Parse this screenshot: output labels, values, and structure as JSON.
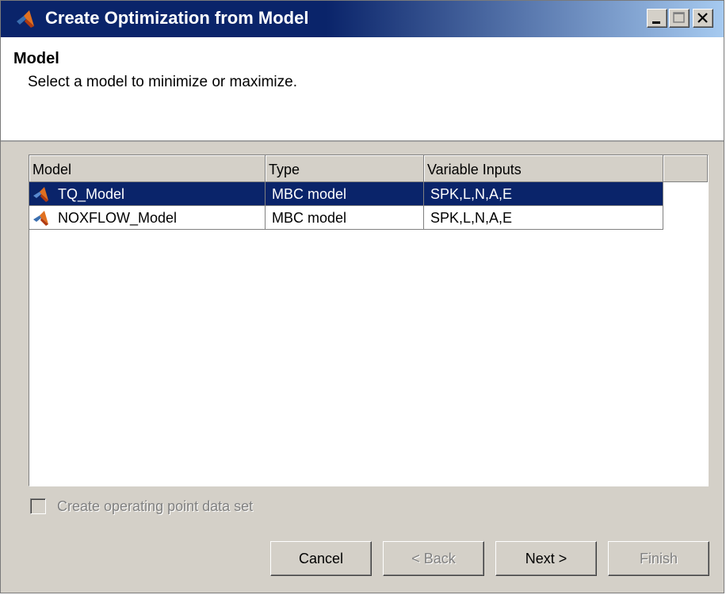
{
  "window": {
    "title": "Create Optimization from Model",
    "minimize_label": "_",
    "maximize_label": "□",
    "close_label": "×"
  },
  "header": {
    "title": "Model",
    "description": "Select a model to minimize or maximize."
  },
  "table": {
    "columns": [
      "Model",
      "Type",
      "Variable Inputs"
    ],
    "rows": [
      {
        "model": "TQ_Model",
        "type": "MBC model",
        "inputs": "SPK,L,N,A,E",
        "selected": true,
        "icon": "matlab-model-icon"
      },
      {
        "model": "NOXFLOW_Model",
        "type": "MBC model",
        "inputs": "SPK,L,N,A,E",
        "selected": false,
        "icon": "matlab-model-icon"
      }
    ]
  },
  "options": {
    "create_opdata_label": "Create operating point data set",
    "create_opdata_checked": false,
    "create_opdata_enabled": false
  },
  "buttons": {
    "cancel": "Cancel",
    "back": "< Back",
    "next": "Next >",
    "finish": "Finish"
  },
  "colors": {
    "titlebar_start": "#0a246a",
    "titlebar_end": "#a6caf0",
    "selection": "#0a246a",
    "dialog_bg": "#d4d0c8"
  }
}
